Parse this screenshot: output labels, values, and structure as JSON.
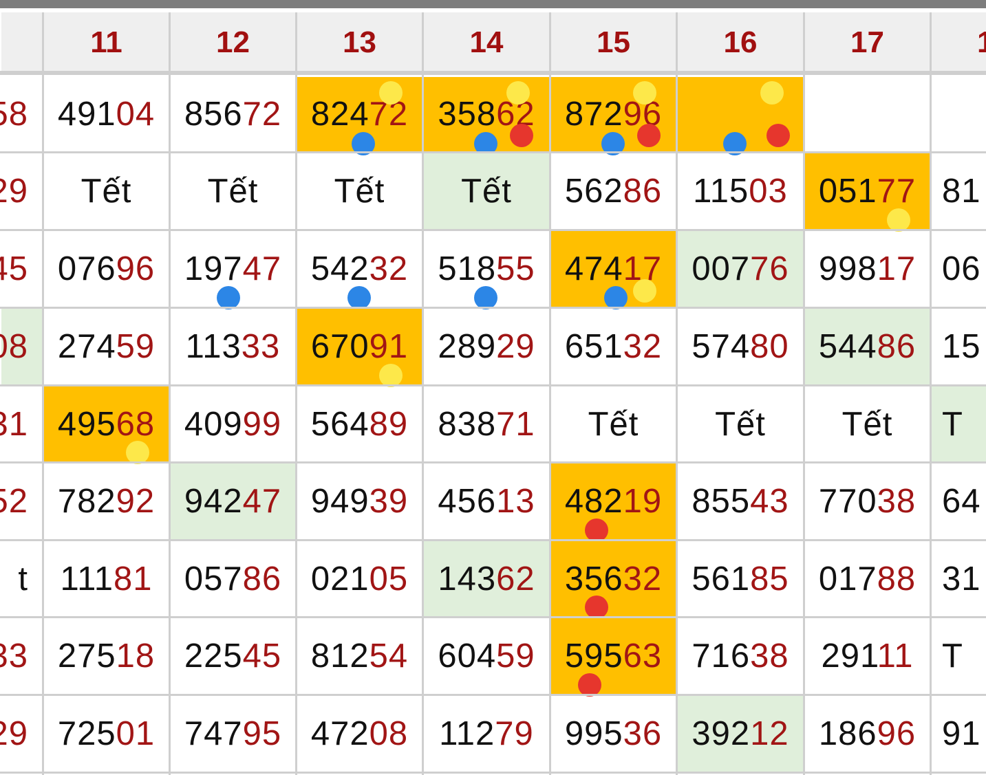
{
  "header": {
    "columns": [
      "",
      "11",
      "12",
      "13",
      "14",
      "15",
      "16",
      "17",
      "1"
    ]
  },
  "colors": {
    "highlight_yellow": "#ffbf00",
    "highlight_green": "#e0efdb",
    "digit_red": "#a11515",
    "dot_blue": "#2c86e6",
    "dot_red": "#e6362d",
    "dot_yellow": "#fde84a"
  },
  "rows": [
    [
      {
        "a": "",
        "b": "58"
      },
      {
        "a": "491",
        "b": "04"
      },
      {
        "a": "856",
        "b": "72"
      },
      {
        "a": "824",
        "b": "72",
        "bg": "y",
        "dots": [
          "yellow",
          "blue"
        ]
      },
      {
        "a": "358",
        "b": "62",
        "bg": "y",
        "dots": [
          "yellow",
          "blue",
          "red"
        ]
      },
      {
        "a": "872",
        "b": "96",
        "bg": "y",
        "dots": [
          "yellow",
          "blue",
          "red"
        ]
      },
      {
        "a": "",
        "b": "",
        "bg": "y",
        "dots": [
          "yellow",
          "blue",
          "red"
        ]
      },
      {
        "a": "",
        "b": ""
      },
      {
        "a": "",
        "b": ""
      }
    ],
    [
      {
        "a": "",
        "b": "29"
      },
      {
        "a": "Tết",
        "b": ""
      },
      {
        "a": "Tết",
        "b": ""
      },
      {
        "a": "Tết",
        "b": ""
      },
      {
        "a": "Tết",
        "b": "",
        "bg": "g"
      },
      {
        "a": "562",
        "b": "86"
      },
      {
        "a": "115",
        "b": "03"
      },
      {
        "a": "051",
        "b": "77",
        "bg": "y",
        "dots": [
          "yellow"
        ]
      },
      {
        "a": "81",
        "b": ""
      }
    ],
    [
      {
        "a": "",
        "b": "45"
      },
      {
        "a": "076",
        "b": "96"
      },
      {
        "a": "197",
        "b": "47",
        "dots": [
          "blue"
        ]
      },
      {
        "a": "542",
        "b": "32",
        "dots": [
          "blue"
        ]
      },
      {
        "a": "518",
        "b": "55",
        "dots": [
          "blue"
        ]
      },
      {
        "a": "474",
        "b": "17",
        "bg": "y",
        "dots": [
          "blue",
          "yellow"
        ]
      },
      {
        "a": "007",
        "b": "76",
        "bg": "g"
      },
      {
        "a": "998",
        "b": "17"
      },
      {
        "a": "06",
        "b": ""
      }
    ],
    [
      {
        "a": "",
        "b": "08",
        "bg": "g"
      },
      {
        "a": "274",
        "b": "59"
      },
      {
        "a": "113",
        "b": "33"
      },
      {
        "a": "670",
        "b": "91",
        "bg": "y",
        "dots": [
          "yellow"
        ]
      },
      {
        "a": "289",
        "b": "29"
      },
      {
        "a": "651",
        "b": "32"
      },
      {
        "a": "574",
        "b": "80"
      },
      {
        "a": "544",
        "b": "86",
        "bg": "g"
      },
      {
        "a": "15",
        "b": ""
      }
    ],
    [
      {
        "a": "",
        "b": "31"
      },
      {
        "a": "495",
        "b": "68",
        "bg": "y",
        "dots": [
          "yellow"
        ]
      },
      {
        "a": "409",
        "b": "99"
      },
      {
        "a": "564",
        "b": "89"
      },
      {
        "a": "838",
        "b": "71"
      },
      {
        "a": "Tết",
        "b": ""
      },
      {
        "a": "Tết",
        "b": ""
      },
      {
        "a": "Tết",
        "b": ""
      },
      {
        "a": "T",
        "b": "",
        "bg": "g"
      }
    ],
    [
      {
        "a": "",
        "b": "52"
      },
      {
        "a": "782",
        "b": "92"
      },
      {
        "a": "942",
        "b": "47",
        "bg": "g"
      },
      {
        "a": "949",
        "b": "39"
      },
      {
        "a": "456",
        "b": "13"
      },
      {
        "a": "482",
        "b": "19",
        "bg": "y",
        "dots": [
          "red"
        ]
      },
      {
        "a": "855",
        "b": "43"
      },
      {
        "a": "770",
        "b": "38"
      },
      {
        "a": "64",
        "b": ""
      }
    ],
    [
      {
        "a": "t",
        "b": ""
      },
      {
        "a": "111",
        "b": "81"
      },
      {
        "a": "057",
        "b": "86"
      },
      {
        "a": "021",
        "b": "05"
      },
      {
        "a": "143",
        "b": "62",
        "bg": "g"
      },
      {
        "a": "356",
        "b": "32",
        "bg": "y",
        "dots": [
          "red"
        ]
      },
      {
        "a": "561",
        "b": "85"
      },
      {
        "a": "017",
        "b": "88"
      },
      {
        "a": "31",
        "b": ""
      }
    ],
    [
      {
        "a": "",
        "b": "33"
      },
      {
        "a": "275",
        "b": "18"
      },
      {
        "a": "225",
        "b": "45"
      },
      {
        "a": "812",
        "b": "54"
      },
      {
        "a": "604",
        "b": "59"
      },
      {
        "a": "595",
        "b": "63",
        "bg": "y",
        "dots": [
          "red"
        ]
      },
      {
        "a": "716",
        "b": "38"
      },
      {
        "a": "291",
        "b": "11"
      },
      {
        "a": "T",
        "b": ""
      }
    ],
    [
      {
        "a": "",
        "b": "29"
      },
      {
        "a": "725",
        "b": "01"
      },
      {
        "a": "747",
        "b": "95"
      },
      {
        "a": "472",
        "b": "08"
      },
      {
        "a": "112",
        "b": "79"
      },
      {
        "a": "995",
        "b": "36"
      },
      {
        "a": "392",
        "b": "12",
        "bg": "g"
      },
      {
        "a": "186",
        "b": "96"
      },
      {
        "a": "91",
        "b": ""
      }
    ]
  ]
}
